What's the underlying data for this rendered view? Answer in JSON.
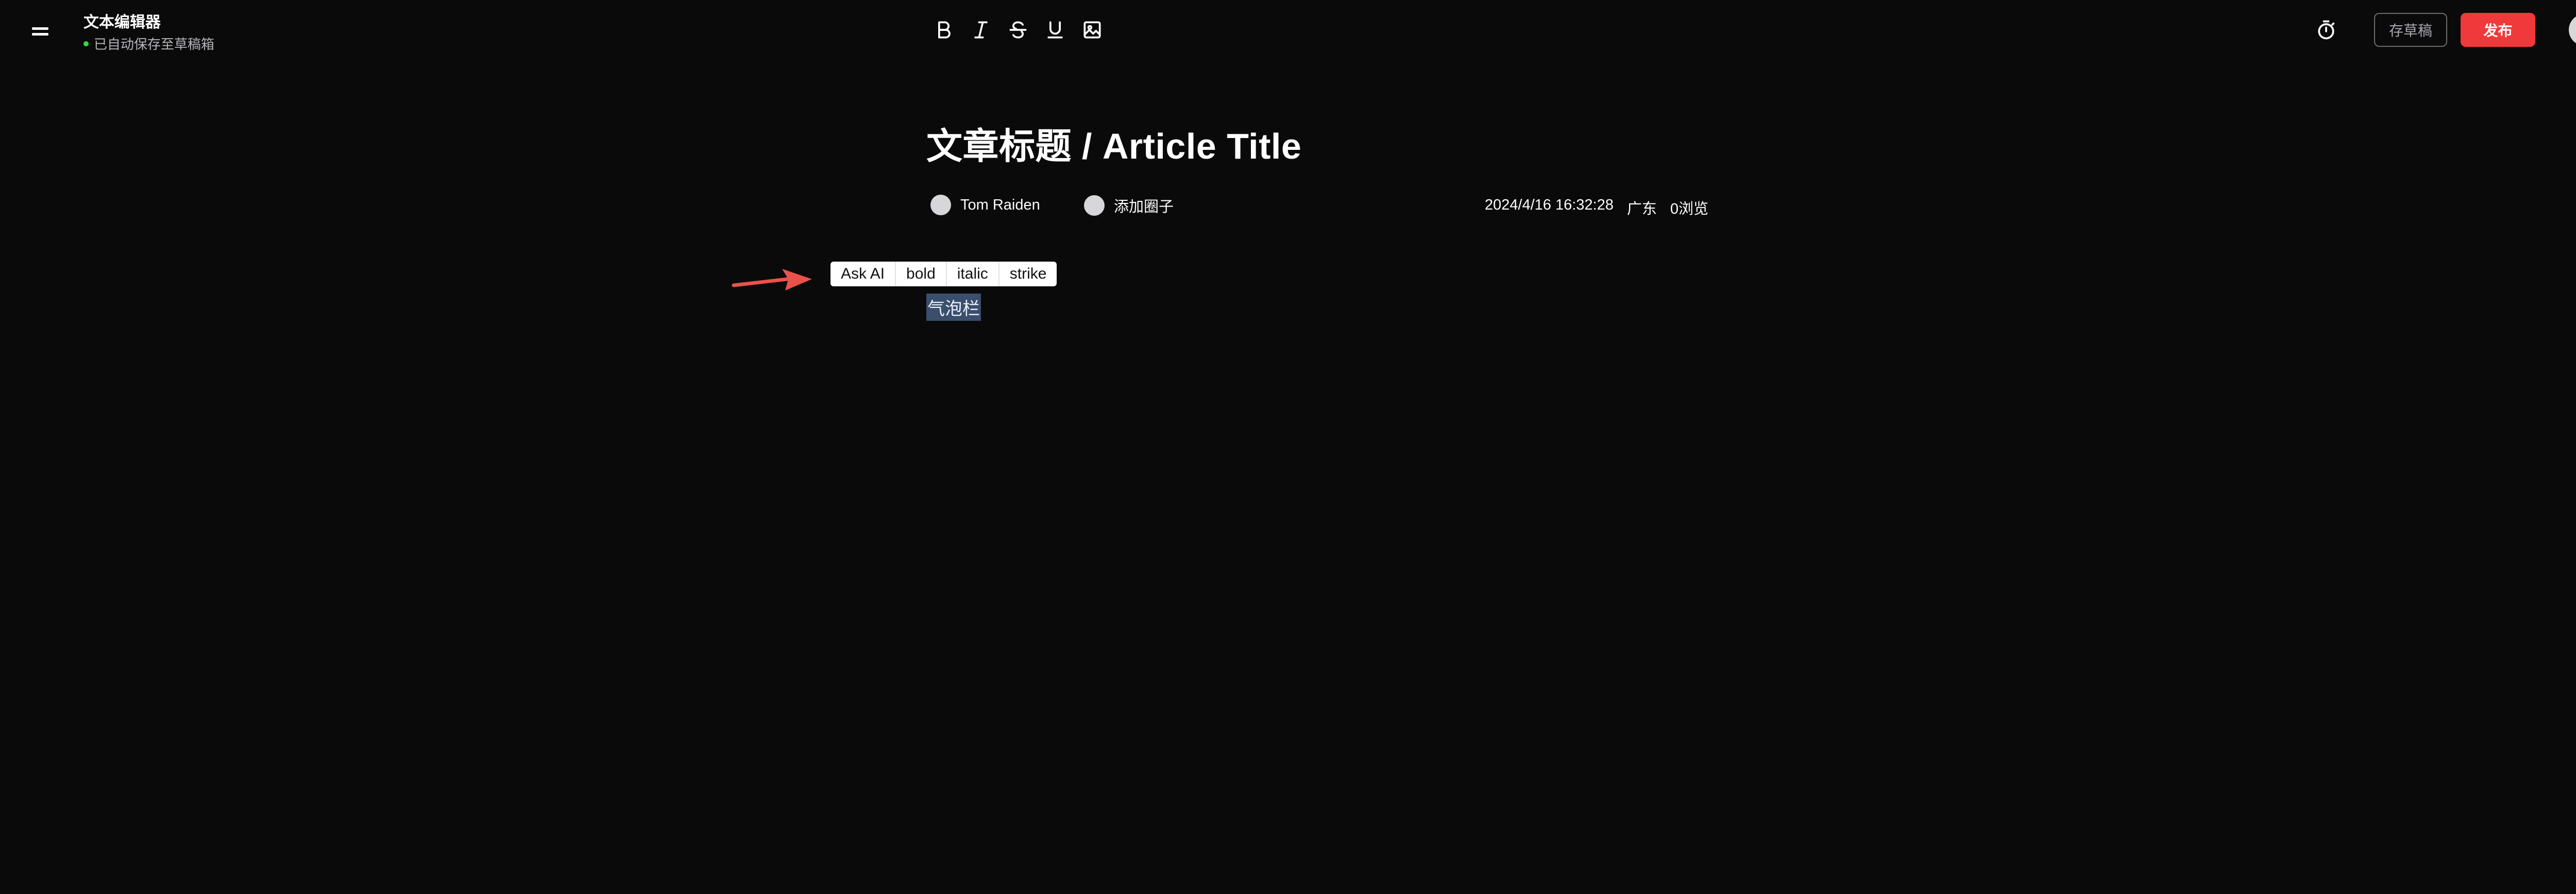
{
  "header": {
    "app_title": "文本编辑器",
    "save_status": "已自动保存至草稿箱",
    "status_dot_color": "#32d74b",
    "format_tools": [
      "bold-icon",
      "italic-icon",
      "strikethrough-icon",
      "underline-icon",
      "image-icon"
    ],
    "timer_icon": "timer-icon",
    "draft_label": "存草稿",
    "publish_label": "发布",
    "publish_color": "#f0393a"
  },
  "article": {
    "title": "文章标题 / Article Title",
    "author_name": "Tom Raiden",
    "add_circle_label": "添加圈子",
    "datetime": "2024/4/16 16:32:28",
    "location": "广东",
    "views": "0浏览"
  },
  "bubble_menu": {
    "items": [
      "Ask AI",
      "bold",
      "italic",
      "strike"
    ]
  },
  "editor": {
    "selected_text": "气泡栏",
    "selection_color": "#3a4e6e"
  },
  "annotation": {
    "arrow_color": "#e8524b"
  }
}
